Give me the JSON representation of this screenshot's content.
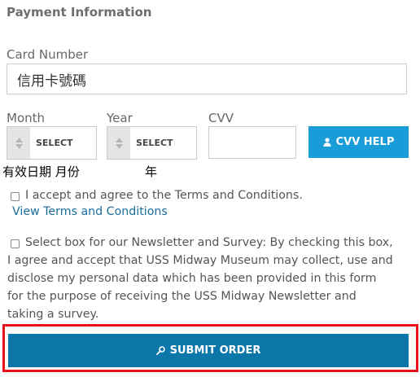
{
  "section_title": "Payment Information",
  "card_number": {
    "label": "Card Number",
    "value": "信用卡號碼"
  },
  "month": {
    "label": "Month",
    "selected": "SELECT",
    "annotation": "有效日期 月份"
  },
  "year": {
    "label": "Year",
    "selected": "SELECT",
    "annotation": "年"
  },
  "cvv": {
    "label": "CVV",
    "value": ""
  },
  "cvv_help": {
    "label": "CVV HELP",
    "icon": "person-icon"
  },
  "terms": {
    "checkbox_label": "I accept and agree to the Terms and Conditions.",
    "checked": false,
    "link_text": "View Terms and Conditions"
  },
  "newsletter": {
    "checked": false,
    "line1": "Select box for our Newsletter and Survey: By checking this box,",
    "line2": "I agree and accept that USS Midway Museum may collect, use and",
    "line3": "disclose my personal data which has been provided in this form",
    "line4": "for the purpose of receiving the USS Midway Newsletter and",
    "line5": "taking a survey."
  },
  "submit": {
    "label": "SUBMIT ORDER",
    "icon": "key-icon"
  },
  "colors": {
    "cvv_button": "#1a9cd9",
    "submit_button": "#0d77a9",
    "highlight_frame": "#e8131a",
    "link": "#1a6e9c"
  }
}
